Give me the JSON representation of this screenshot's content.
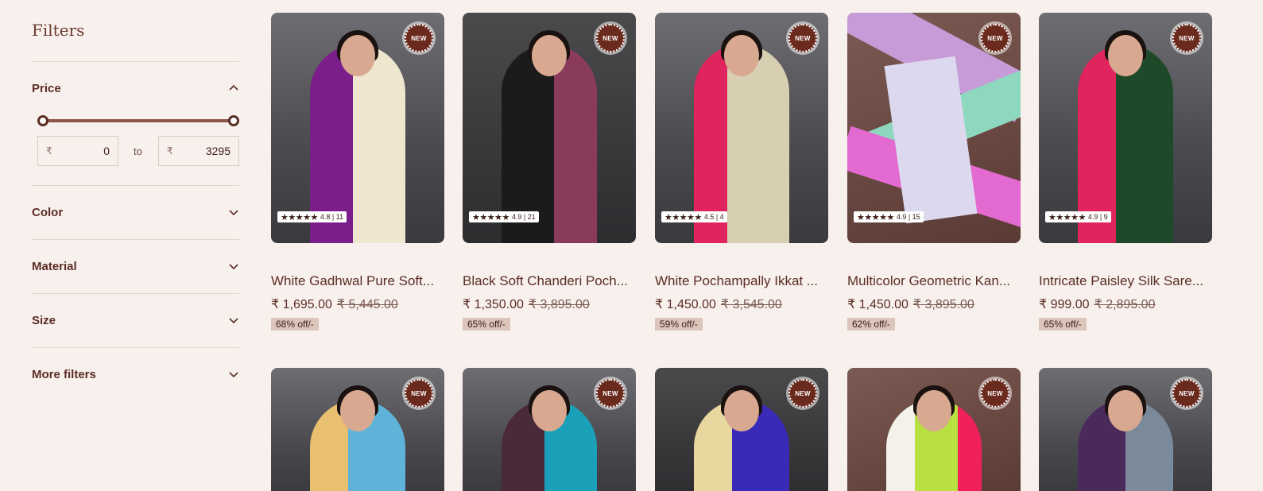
{
  "filters": {
    "title": "Filters",
    "price": {
      "label": "Price",
      "currency": "₹",
      "min": "0",
      "max": "3295",
      "to_label": "to"
    },
    "facets": [
      "Color",
      "Material",
      "Size",
      "More filters"
    ]
  },
  "products": [
    {
      "name": "White Gadhwal Pure Soft...",
      "price": "₹ 1,695.00",
      "mrp": "₹ 5,445.00",
      "off": "68% off/-",
      "rating": "4.8 | 11",
      "badge": "NEW",
      "colors": [
        "#7b1d8a",
        "#efe6cf"
      ]
    },
    {
      "name": "Black Soft Chanderi Poch...",
      "price": "₹ 1,350.00",
      "mrp": "₹ 3,895.00",
      "off": "65% off/-",
      "rating": "4.9 | 21",
      "badge": "NEW",
      "colors": [
        "#1b1b1b",
        "#8a3a5a"
      ]
    },
    {
      "name": "White Pochampally Ikkat ...",
      "price": "₹ 1,450.00",
      "mrp": "₹ 3,545.00",
      "off": "59% off/-",
      "rating": "4.5 | 4",
      "badge": "NEW",
      "colors": [
        "#d8cfb2",
        "#e0245e"
      ]
    },
    {
      "name": "Multicolor Geometric Kan...",
      "price": "₹ 1,450.00",
      "mrp": "₹ 3,895.00",
      "off": "62% off/-",
      "rating": "4.9 | 15",
      "badge": "NEW",
      "colors": [
        "#c79ad8",
        "#8ed8c0"
      ]
    },
    {
      "name": "Intricate Paisley Silk Sare...",
      "price": "₹ 999.00",
      "mrp": "₹ 2,895.00",
      "off": "65% off/-",
      "rating": "4.9 | 9",
      "badge": "NEW",
      "colors": [
        "#1f4a2a",
        "#e0245e"
      ]
    }
  ],
  "products_row2": [
    {
      "badge": "NEW",
      "colors": [
        "#5fb3d8",
        "#e8c070"
      ]
    },
    {
      "badge": "NEW",
      "colors": [
        "#1aa0b8",
        "#4a2a3a"
      ]
    },
    {
      "badge": "NEW",
      "colors": [
        "#3a2ab8",
        "#e8d8a0"
      ]
    },
    {
      "badge": "NEW",
      "colors": [
        "#b8e040",
        "#f0205a"
      ]
    },
    {
      "badge": "NEW",
      "colors": [
        "#4a2a5a",
        "#7a8a9a"
      ]
    }
  ],
  "stars_glyph": "★★★★★",
  "colors": {
    "accent": "#5a2d24",
    "background": "#f8f0ed",
    "badge": "#6b2a1e"
  }
}
